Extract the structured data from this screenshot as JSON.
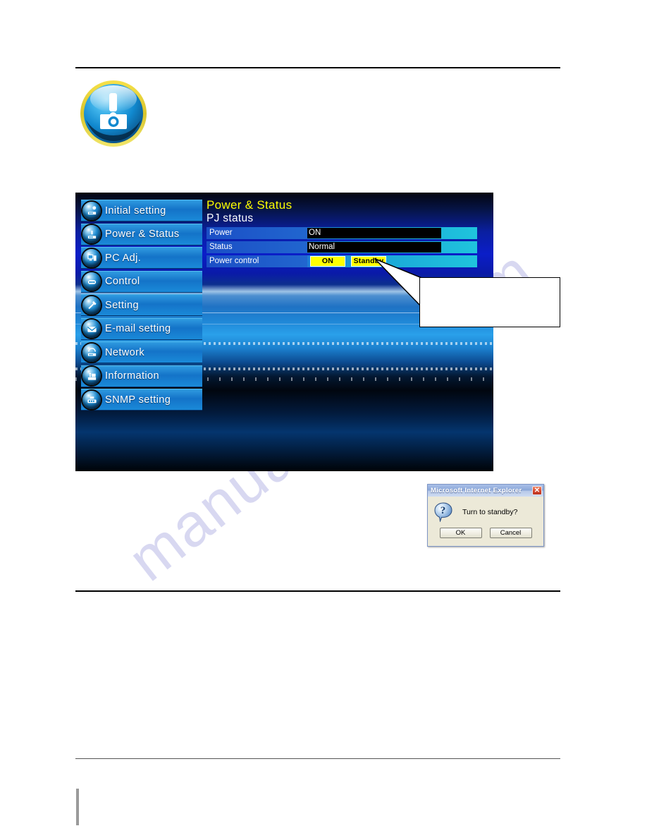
{
  "watermark": {
    "text": "manualshive.com"
  },
  "caution_badge": {
    "icon": "projector-warning-icon"
  },
  "screenshot": {
    "sidebar": {
      "items": [
        {
          "label": "Initial setting",
          "icon": "initial-setting-icon"
        },
        {
          "label": "Power & Status",
          "icon": "power-status-icon"
        },
        {
          "label": "PC Adj.",
          "icon": "pc-adj-icon"
        },
        {
          "label": "Control",
          "icon": "control-icon"
        },
        {
          "label": "Setting",
          "icon": "setting-icon"
        },
        {
          "label": "E-mail setting",
          "icon": "email-setting-icon"
        },
        {
          "label": "Network",
          "icon": "network-icon"
        },
        {
          "label": "Information",
          "icon": "information-icon"
        },
        {
          "label": "SNMP setting",
          "icon": "snmp-setting-icon"
        }
      ]
    },
    "content": {
      "title": "Power & Status",
      "subtitle": "PJ status",
      "rows": [
        {
          "key": "Power",
          "value": "ON"
        },
        {
          "key": "Status",
          "value": "Normal"
        }
      ],
      "power_control": {
        "key": "Power control",
        "on_label": "ON",
        "standby_label": "Standby"
      }
    },
    "colors": {
      "title_yellow": "#ffff00",
      "button_yellow": "#ffff00",
      "menu_blue": "#1473c8",
      "field_black": "#000000"
    }
  },
  "callout": {
    "text": ""
  },
  "dialog": {
    "title": "Microsoft Internet Explorer",
    "close_label": "✕",
    "message": "Turn to standby?",
    "icon": "question-icon",
    "buttons": [
      {
        "label": "OK"
      },
      {
        "label": "Cancel"
      }
    ]
  }
}
